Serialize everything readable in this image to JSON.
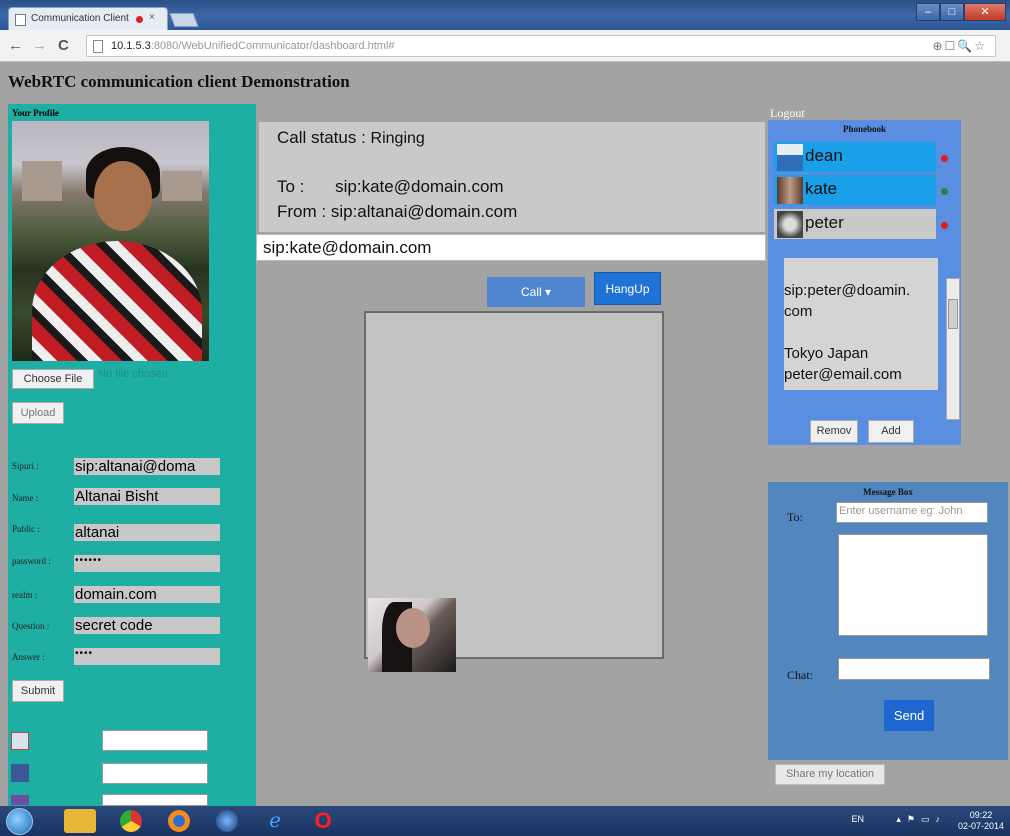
{
  "browser": {
    "tab_title": "Communication Client",
    "tab_close": "×",
    "url_host": "10.1.5.3",
    "url_rest": ":8080/WebUnifiedCommunicator/dashboard.html#",
    "back": "←",
    "forward": "→",
    "reload": "C"
  },
  "page": {
    "title": "WebRTC communication client Demonstration"
  },
  "profile": {
    "heading": "Your Profile",
    "choose_file_label": "Choose File",
    "no_file_label": "No file chosen",
    "upload_label": "Upload",
    "fields": [
      {
        "label": "Sipuri :",
        "value": "sip:altanai@doma"
      },
      {
        "label": "Name :",
        "value": "Altanai Bisht"
      },
      {
        "label": "Public :",
        "value": "altanai"
      },
      {
        "label": "password :",
        "value": "••••••"
      },
      {
        "label": "realm :",
        "value": "domain.com"
      },
      {
        "label": "Question :",
        "value": "secret code"
      },
      {
        "label": "Answer :",
        "value": "••••"
      }
    ],
    "submit_label": "Submit"
  },
  "call": {
    "status_label": "Call status :",
    "status_value": "Ringing",
    "to_label": "To :",
    "to_value": "sip:kate@domain.com",
    "from_label": "From :",
    "from_value": "sip:altanai@domain.com",
    "target_value": "sip:kate@domain.com",
    "call_button": "Call ▾",
    "hangup_button": "HangUp"
  },
  "phonebook": {
    "logout": "Logout",
    "title": "Phonebook",
    "contacts": [
      {
        "name": "dean",
        "presence_color": "#e01b1b",
        "highlight": "#1aa0e8"
      },
      {
        "name": "kate",
        "presence_color": "#1b8a3a",
        "highlight": "#1aa0e8"
      },
      {
        "name": "peter",
        "presence_color": "#e01b1b",
        "highlight": "#c9c9c9"
      }
    ],
    "detail_lines": [
      "sip:peter@doamin.",
      "com",
      "",
      "Tokyo Japan",
      "peter@email.com"
    ],
    "remove_label": "Remov",
    "add_label": "Add"
  },
  "message": {
    "title": "Message Box",
    "to_label": "To:",
    "to_placeholder": "Enter username eg: John",
    "chat_label": "Chat:",
    "send_label": "Send",
    "share_label": "Share my location"
  },
  "taskbar": {
    "lang": "EN",
    "time": "09:22",
    "date": "02-07-2014"
  },
  "colors": {
    "profile_panel": "#1faea3",
    "phonebook_panel": "#5a8ee0",
    "message_panel": "#5286bf",
    "page_bg": "#a3a3a3"
  }
}
